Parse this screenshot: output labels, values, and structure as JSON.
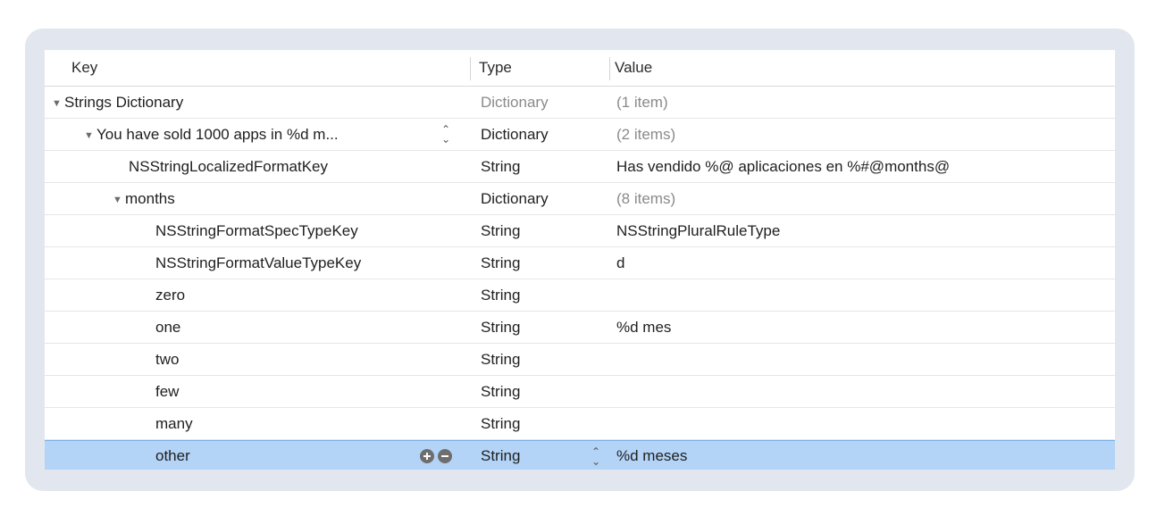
{
  "header": {
    "key": "Key",
    "type": "Type",
    "value": "Value"
  },
  "rows": [
    {
      "key": "Strings Dictionary",
      "type": "Dictionary",
      "value": "(1 item)"
    },
    {
      "key": "You have sold 1000 apps in %d m...",
      "type": "Dictionary",
      "value": "(2 items)"
    },
    {
      "key": "NSStringLocalizedFormatKey",
      "type": "String",
      "value": "Has vendido %@ aplicaciones en %#@months@"
    },
    {
      "key": "months",
      "type": "Dictionary",
      "value": "(8 items)"
    },
    {
      "key": "NSStringFormatSpecTypeKey",
      "type": "String",
      "value": "NSStringPluralRuleType"
    },
    {
      "key": "NSStringFormatValueTypeKey",
      "type": "String",
      "value": "d"
    },
    {
      "key": "zero",
      "type": "String",
      "value": ""
    },
    {
      "key": "one",
      "type": "String",
      "value": "%d mes"
    },
    {
      "key": "two",
      "type": "String",
      "value": ""
    },
    {
      "key": "few",
      "type": "String",
      "value": ""
    },
    {
      "key": "many",
      "type": "String",
      "value": ""
    },
    {
      "key": "other",
      "type": "String",
      "value": "%d meses"
    }
  ],
  "icons": {
    "expanded": "disclosure-triangle-down-icon",
    "stepper": "up-down-chevron-icon",
    "add": "plus-circle-icon",
    "remove": "minus-circle-icon"
  },
  "colors": {
    "frame": "#e2e7ef",
    "selection": "#b3d4f7",
    "muted_text": "#8a8a8a"
  }
}
